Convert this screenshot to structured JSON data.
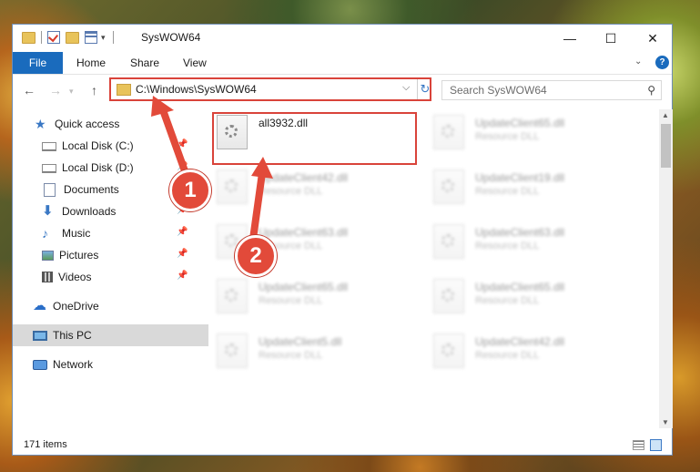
{
  "window": {
    "title": "SysWOW64",
    "controls": {
      "minimize": "—",
      "maximize": "☐",
      "close": "✕"
    }
  },
  "ribbon": {
    "tabs": [
      "File",
      "Home",
      "Share",
      "View"
    ],
    "collapse": "⌄",
    "help": "?"
  },
  "address": {
    "path": "C:\\Windows\\SysWOW64",
    "search_placeholder": "Search SysWOW64"
  },
  "sidebar": {
    "items": [
      {
        "label": "Quick access",
        "icon": "star-icon",
        "pinned": false
      },
      {
        "label": "Local Disk (C:)",
        "icon": "disk-icon",
        "pinned": true
      },
      {
        "label": "Local Disk (D:)",
        "icon": "disk-icon",
        "pinned": true
      },
      {
        "label": "Documents",
        "icon": "document-icon",
        "pinned": true
      },
      {
        "label": "Downloads",
        "icon": "download-icon",
        "pinned": true
      },
      {
        "label": "Music",
        "icon": "music-icon",
        "pinned": true
      },
      {
        "label": "Pictures",
        "icon": "pictures-icon",
        "pinned": true
      },
      {
        "label": "Videos",
        "icon": "video-icon",
        "pinned": true
      },
      {
        "label": "OneDrive",
        "icon": "cloud-icon",
        "pinned": false
      },
      {
        "label": "This PC",
        "icon": "computer-icon",
        "pinned": false,
        "selected": true
      },
      {
        "label": "Network",
        "icon": "network-icon",
        "pinned": false
      }
    ]
  },
  "files": [
    {
      "name": "all3932.dll",
      "type": ""
    },
    {
      "name": "UpdateClient65.dll",
      "type": "Resource DLL"
    },
    {
      "name": "UpdateClient42.dll",
      "type": "Resource DLL"
    },
    {
      "name": "UpdateClient19.dll",
      "type": "Resource DLL"
    },
    {
      "name": "UpdateClient63.dll",
      "type": "Resource DLL"
    },
    {
      "name": "UpdateClient63.dll",
      "type": "Resource DLL"
    },
    {
      "name": "UpdateClient65.dll",
      "type": "Resource DLL"
    },
    {
      "name": "UpdateClient65.dll",
      "type": "Resource DLL"
    },
    {
      "name": "UpdateClient5.dll",
      "type": "Resource DLL"
    },
    {
      "name": "UpdateClient42.dll",
      "type": "Resource DLL"
    }
  ],
  "status": {
    "item_count": "171 items"
  },
  "annotations": {
    "step1": "1",
    "step2": "2",
    "accent_color": "#e24a3a"
  }
}
